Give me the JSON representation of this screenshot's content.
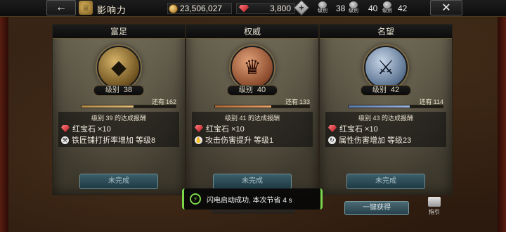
{
  "header": {
    "back_icon": "back-arrow-icon",
    "title": "影响力",
    "gold": "23,506,027",
    "rubies": "3,800",
    "badges": [
      {
        "label": "级别",
        "value": "38"
      },
      {
        "label": "级别",
        "value": "40"
      },
      {
        "label": "级别",
        "value": "42"
      }
    ],
    "close_icon": "close-icon"
  },
  "panels": [
    {
      "name": "富足",
      "emblem_icon": "diamond-emblem-icon",
      "level_label": "级别",
      "level": "38",
      "remain_label": "还有",
      "remain": "162",
      "progress": 0.55,
      "reward_title": "级别 39 的达成报酬",
      "reward_1": "红宝石 ×10",
      "reward_2": "铁匠铺打折率增加  等级8",
      "status": "未完成"
    },
    {
      "name": "权威",
      "emblem_icon": "crown-emblem-icon",
      "level_label": "级别",
      "level": "40",
      "remain_label": "还有",
      "remain": "133",
      "progress": 0.6,
      "reward_title": "级别 41 的达成报酬",
      "reward_1": "红宝石 ×10",
      "reward_2": "攻击伤害提升  等级1",
      "status": "未完成"
    },
    {
      "name": "名望",
      "emblem_icon": "shield-emblem-icon",
      "level_label": "级别",
      "level": "42",
      "remain_label": "还有",
      "remain": "114",
      "progress": 0.65,
      "reward_title": "级别 43 的达成报酬",
      "reward_1": "红宝石 ×10",
      "reward_2": "属性伤害增加  等级23",
      "status": "未完成"
    }
  ],
  "footer": {
    "claim_all": "一键获得",
    "guide": "指引"
  },
  "toast": {
    "text": "闪电启动成功, 本次节省 4 s"
  }
}
